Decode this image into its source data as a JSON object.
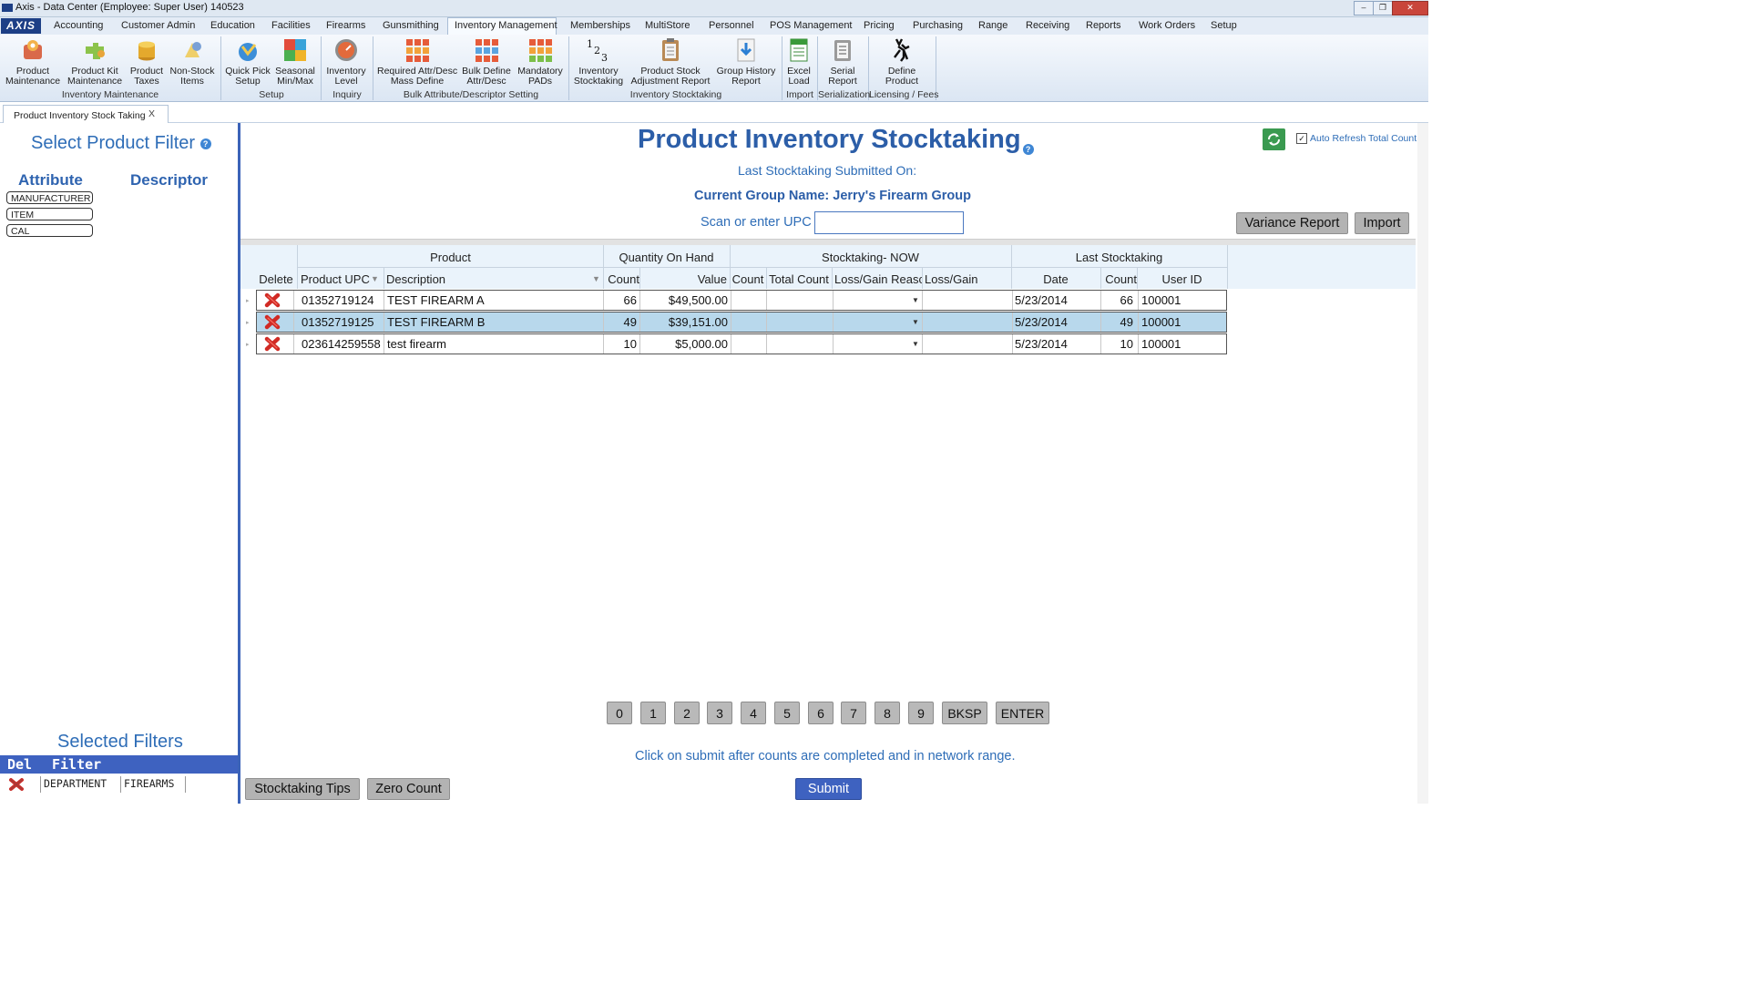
{
  "window": {
    "title": "Axis - Data Center  (Employee: Super User) 140523"
  },
  "menu": {
    "logo": "AXIS",
    "tabs": [
      "Accounting",
      "Customer Admin",
      "Education",
      "Facilities",
      "Firearms",
      "Gunsmithing",
      "Inventory Management",
      "Memberships",
      "MultiStore",
      "Personnel",
      "POS Management",
      "Pricing",
      "Purchasing",
      "Range",
      "Receiving",
      "Reports",
      "Work Orders",
      "Setup"
    ],
    "active": "Inventory Management"
  },
  "ribbon": {
    "buttons": [
      {
        "l1": "Product",
        "l2": "Maintenance",
        "icon": "product-maintenance-icon"
      },
      {
        "l1": "Product Kit",
        "l2": "Maintenance",
        "icon": "product-kit-icon"
      },
      {
        "l1": "Product",
        "l2": "Taxes",
        "icon": "coins-icon"
      },
      {
        "l1": "Non-Stock",
        "l2": "Items",
        "icon": "non-stock-icon"
      },
      {
        "l1": "Quick Pick",
        "l2": "Setup",
        "icon": "quick-pick-icon"
      },
      {
        "l1": "Seasonal",
        "l2": "Min/Max",
        "icon": "seasonal-icon"
      },
      {
        "l1": "Inventory",
        "l2": "Level",
        "icon": "gauge-icon"
      },
      {
        "l1": "Required Attr/Desc",
        "l2": "Mass Define",
        "icon": "grid-icon"
      },
      {
        "l1": "Bulk Define",
        "l2": "Attr/Desc",
        "icon": "grid-icon"
      },
      {
        "l1": "Mandatory",
        "l2": "PADs",
        "icon": "grid-icon"
      },
      {
        "l1": "Inventory",
        "l2": "Stocktaking",
        "icon": "numbers-icon"
      },
      {
        "l1": "Product Stock",
        "l2": "Adjustment Report",
        "icon": "clipboard-icon"
      },
      {
        "l1": "Group History",
        "l2": "Report",
        "icon": "download-icon"
      },
      {
        "l1": "Excel",
        "l2": "Load",
        "icon": "excel-icon"
      },
      {
        "l1": "Serial",
        "l2": "Report",
        "icon": "serial-report-icon"
      },
      {
        "l1": "Define",
        "l2": "Product",
        "icon": "deer-icon"
      }
    ],
    "groups": [
      "Inventory Maintenance",
      "Setup",
      "Inquiry",
      "Bulk Attribute/Descriptor Setting",
      "Inventory Stocktaking",
      "Import",
      "Serialization",
      "Licensing / Fees"
    ]
  },
  "doc_tab": {
    "title": "Product Inventory Stock Taking",
    "close": "X"
  },
  "left": {
    "title": "Select Product Filter",
    "help": "?",
    "attribute_header": "Attribute",
    "descriptor_header": "Descriptor",
    "attributes": [
      "MANUFACTURER",
      "ITEM",
      "CAL"
    ],
    "selected_title": "Selected Filters",
    "sel_del": "Del",
    "sel_filter": "Filter",
    "filters": [
      {
        "attribute": "DEPARTMENT",
        "value": "FIREARMS"
      }
    ]
  },
  "main": {
    "title": "Product Inventory Stocktaking",
    "help": "?",
    "last_submitted": "Last Stocktaking Submitted On:",
    "group_name": "Current Group Name: Jerry's Firearm Group",
    "scan_label": "Scan or enter UPC",
    "scan_value": "",
    "auto_refresh": "Auto Refresh Total Count",
    "auto_refresh_checked": true,
    "variance_report": "Variance Report",
    "import": "Import",
    "hint": "Click on submit after counts are completed and in network range.",
    "stocktaking_tips": "Stocktaking Tips",
    "zero_count": "Zero Count",
    "submit": "Submit",
    "keypad": [
      "0",
      "1",
      "2",
      "3",
      "4",
      "5",
      "6",
      "7",
      "8",
      "9",
      "BKSP",
      "ENTER"
    ]
  },
  "grid": {
    "groups": {
      "product": "Product",
      "qoh": "Quantity On Hand",
      "now": "Stocktaking- NOW",
      "last": "Last Stocktaking"
    },
    "columns": {
      "delete": "Delete",
      "upc": "Product UPC",
      "desc": "Description",
      "qoh_count": "Count",
      "qoh_value": "Value",
      "now_count": "Count",
      "total_count": "Total Count",
      "reason": "Loss/Gain Reasc",
      "loss_gain": "Loss/Gain",
      "last_date": "Date",
      "last_count": "Count",
      "user": "User ID"
    },
    "rows": [
      {
        "upc": "01352719124",
        "desc": "TEST FIREARM A",
        "count": "66",
        "value": "$49,500.00",
        "now_count": "",
        "total": "",
        "reason": "",
        "loss_gain": "",
        "date": "5/23/2014",
        "last_count": "66",
        "user": "100001",
        "selected": false
      },
      {
        "upc": "01352719125",
        "desc": "TEST FIREARM B",
        "count": "49",
        "value": "$39,151.00",
        "now_count": "",
        "total": "",
        "reason": "",
        "loss_gain": "",
        "date": "5/23/2014",
        "last_count": "49",
        "user": "100001",
        "selected": true
      },
      {
        "upc": "023614259558",
        "desc": "test firearm",
        "count": "10",
        "value": "$5,000.00",
        "now_count": "",
        "total": "",
        "reason": "",
        "loss_gain": "",
        "date": "5/23/2014",
        "last_count": "10",
        "user": "100001",
        "selected": false
      }
    ]
  },
  "colors": {
    "accent": "#2e6db7",
    "selected_row": "#b8d8ec",
    "submit": "#3e62c0"
  }
}
